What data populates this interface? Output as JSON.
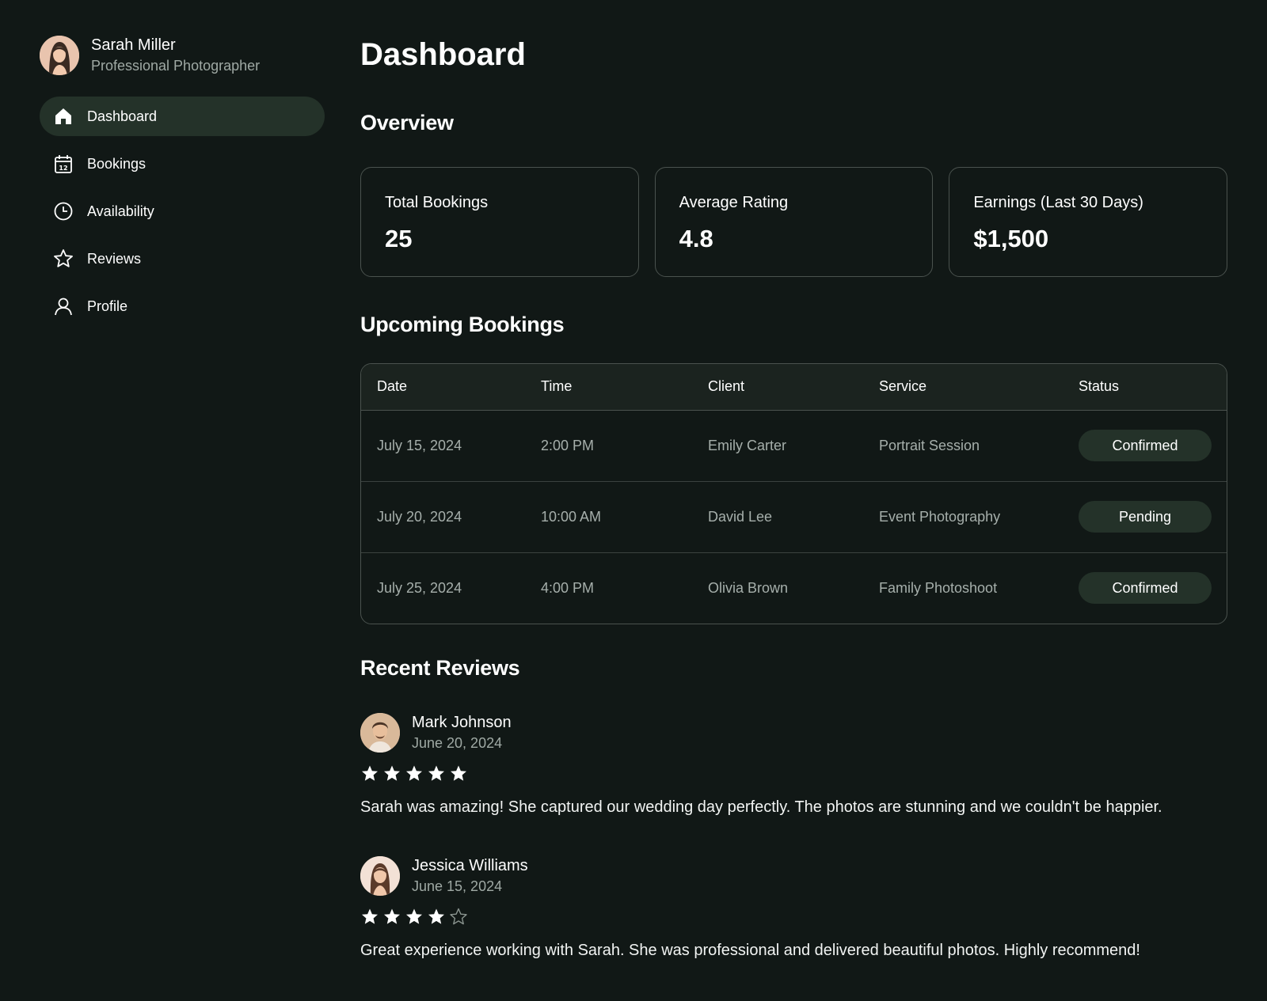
{
  "user": {
    "name": "Sarah Miller",
    "role": "Professional Photographer"
  },
  "sidebar": {
    "items": [
      {
        "label": "Dashboard",
        "icon": "home-icon",
        "active": true
      },
      {
        "label": "Bookings",
        "icon": "calendar-icon"
      },
      {
        "label": "Availability",
        "icon": "clock-icon"
      },
      {
        "label": "Reviews",
        "icon": "star-icon"
      },
      {
        "label": "Profile",
        "icon": "user-icon"
      }
    ]
  },
  "main": {
    "title": "Dashboard",
    "overview_title": "Overview",
    "stats": [
      {
        "label": "Total Bookings",
        "value": "25"
      },
      {
        "label": "Average Rating",
        "value": "4.8"
      },
      {
        "label": "Earnings (Last 30 Days)",
        "value": "$1,500"
      }
    ],
    "bookings_title": "Upcoming Bookings",
    "bookings": {
      "columns": [
        "Date",
        "Time",
        "Client",
        "Service",
        "Status"
      ],
      "rows": [
        {
          "date": "July 15, 2024",
          "time": "2:00 PM",
          "client": "Emily Carter",
          "service": "Portrait Session",
          "status": "Confirmed"
        },
        {
          "date": "July 20, 2024",
          "time": "10:00 AM",
          "client": "David Lee",
          "service": "Event Photography",
          "status": "Pending"
        },
        {
          "date": "July 25, 2024",
          "time": "4:00 PM",
          "client": "Olivia Brown",
          "service": "Family Photoshoot",
          "status": "Confirmed"
        }
      ]
    },
    "reviews_title": "Recent Reviews",
    "reviews": [
      {
        "name": "Mark Johnson",
        "date": "June 20, 2024",
        "rating": 5,
        "text": "Sarah was amazing! She captured our wedding day perfectly. The photos are stunning and we couldn't be happier."
      },
      {
        "name": "Jessica Williams",
        "date": "June 15, 2024",
        "rating": 4,
        "text": "Great experience working with Sarah. She was professional and delivered beautiful photos. Highly recommend!"
      }
    ]
  },
  "colors": {
    "background": "#111816",
    "active_nav": "#243229",
    "pill": "#243229",
    "border": "#4a524e",
    "muted_text": "#9fa9a4"
  }
}
